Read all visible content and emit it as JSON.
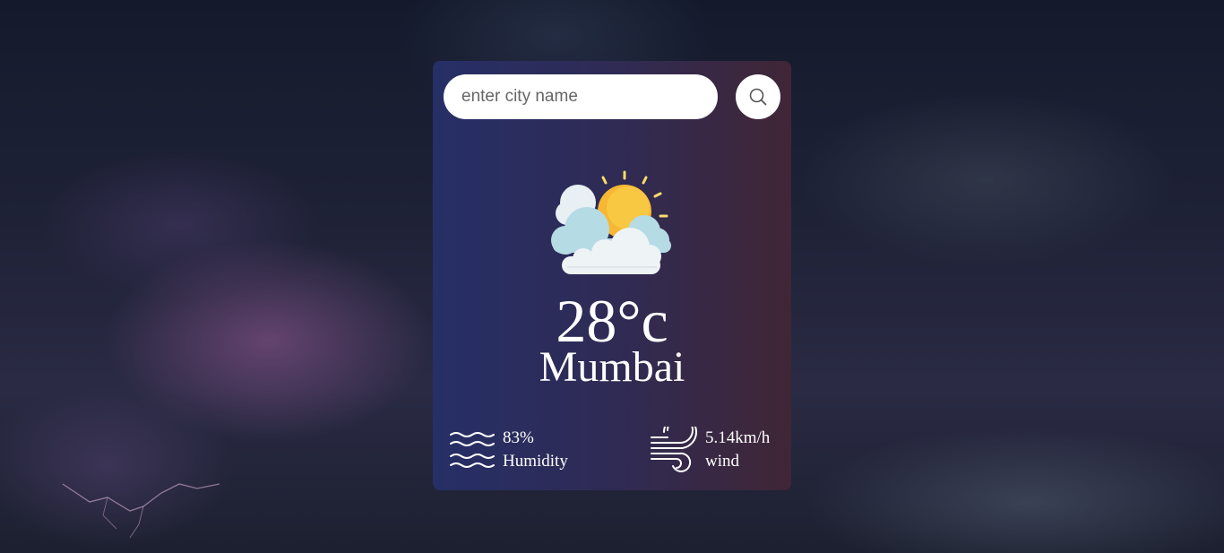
{
  "search": {
    "placeholder": "enter city name",
    "value": ""
  },
  "weather": {
    "icon": "partly-cloudy-sun-icon",
    "temperature": "28°c",
    "city": "Mumbai"
  },
  "details": {
    "humidity": {
      "icon": "waves-icon",
      "value": "83%",
      "label": "Humidity"
    },
    "wind": {
      "icon": "wind-icon",
      "value": "5.14km/h",
      "label": "wind"
    }
  },
  "colors": {
    "card_left": "#262f66",
    "card_right": "#402636",
    "text": "#ffffff",
    "sun": "#f7c142",
    "cloud": "#e9f1f5"
  }
}
